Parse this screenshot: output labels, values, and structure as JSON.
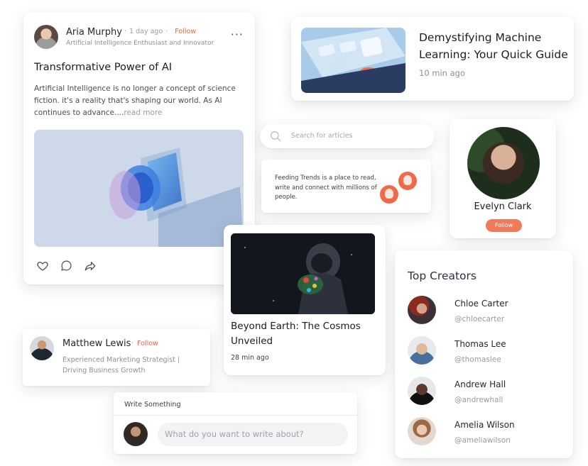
{
  "post": {
    "author": "Aria Murphy",
    "time": "1 day ago",
    "follow": "Follow",
    "role": "Artificial Intelligence Enthusiast and Innovator",
    "title": "Transformative Power of AI",
    "excerpt": "Artificial Intelligence is no longer a concept of science fiction. it's a reality that's shaping our world. As AI continues to advance....",
    "read_more": "read more",
    "more": "···"
  },
  "article": {
    "title": "Demystifying Machine Learning: Your Quick Guide",
    "time": "10 min ago"
  },
  "search": {
    "placeholder": "Search for articles"
  },
  "info": {
    "text": "Feeding Trends is a place to read, write and connect with millions of people."
  },
  "profile": {
    "name": "Evelyn Clark",
    "follow": "Follow"
  },
  "space_post": {
    "title": "Beyond Earth: The Cosmos Unveiled",
    "time": "28 min ago"
  },
  "matthew": {
    "name": "Matthew Lewis",
    "follow": "Follow",
    "role": "Experienced Marketing Strategist | Driving Business Growth"
  },
  "write": {
    "label": "Write Something",
    "placeholder": "What do you want to write about?"
  },
  "creators": {
    "title": "Top Creators",
    "items": [
      {
        "name": "Chloe Carter",
        "handle": "@chloecarter"
      },
      {
        "name": "Thomas Lee",
        "handle": "@thomaslee"
      },
      {
        "name": "Andrew Hall",
        "handle": "@andrewhall"
      },
      {
        "name": "Amelia Wilson",
        "handle": "@ameliawilson"
      }
    ]
  },
  "colors": {
    "accent": "#f0643f",
    "follow_button": "#f07a5a"
  },
  "icons": [
    "heart-icon",
    "comment-icon",
    "share-icon",
    "bookmark-icon",
    "search-icon",
    "more-icon"
  ]
}
